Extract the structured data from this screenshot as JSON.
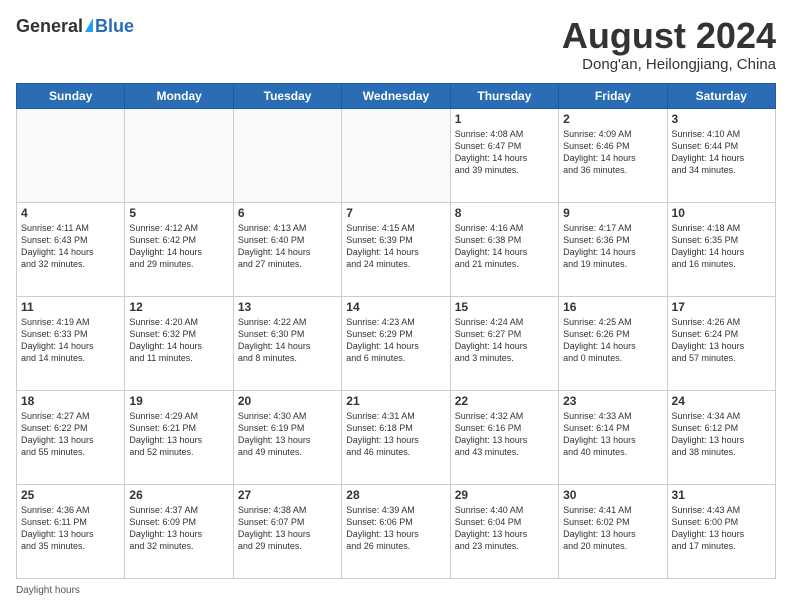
{
  "logo": {
    "general": "General",
    "blue": "Blue"
  },
  "title": {
    "month_year": "August 2024",
    "location": "Dong'an, Heilongjiang, China"
  },
  "days_of_week": [
    "Sunday",
    "Monday",
    "Tuesday",
    "Wednesday",
    "Thursday",
    "Friday",
    "Saturday"
  ],
  "weeks": [
    [
      {
        "day": "",
        "info": ""
      },
      {
        "day": "",
        "info": ""
      },
      {
        "day": "",
        "info": ""
      },
      {
        "day": "",
        "info": ""
      },
      {
        "day": "1",
        "info": "Sunrise: 4:08 AM\nSunset: 6:47 PM\nDaylight: 14 hours\nand 39 minutes."
      },
      {
        "day": "2",
        "info": "Sunrise: 4:09 AM\nSunset: 6:46 PM\nDaylight: 14 hours\nand 36 minutes."
      },
      {
        "day": "3",
        "info": "Sunrise: 4:10 AM\nSunset: 6:44 PM\nDaylight: 14 hours\nand 34 minutes."
      }
    ],
    [
      {
        "day": "4",
        "info": "Sunrise: 4:11 AM\nSunset: 6:43 PM\nDaylight: 14 hours\nand 32 minutes."
      },
      {
        "day": "5",
        "info": "Sunrise: 4:12 AM\nSunset: 6:42 PM\nDaylight: 14 hours\nand 29 minutes."
      },
      {
        "day": "6",
        "info": "Sunrise: 4:13 AM\nSunset: 6:40 PM\nDaylight: 14 hours\nand 27 minutes."
      },
      {
        "day": "7",
        "info": "Sunrise: 4:15 AM\nSunset: 6:39 PM\nDaylight: 14 hours\nand 24 minutes."
      },
      {
        "day": "8",
        "info": "Sunrise: 4:16 AM\nSunset: 6:38 PM\nDaylight: 14 hours\nand 21 minutes."
      },
      {
        "day": "9",
        "info": "Sunrise: 4:17 AM\nSunset: 6:36 PM\nDaylight: 14 hours\nand 19 minutes."
      },
      {
        "day": "10",
        "info": "Sunrise: 4:18 AM\nSunset: 6:35 PM\nDaylight: 14 hours\nand 16 minutes."
      }
    ],
    [
      {
        "day": "11",
        "info": "Sunrise: 4:19 AM\nSunset: 6:33 PM\nDaylight: 14 hours\nand 14 minutes."
      },
      {
        "day": "12",
        "info": "Sunrise: 4:20 AM\nSunset: 6:32 PM\nDaylight: 14 hours\nand 11 minutes."
      },
      {
        "day": "13",
        "info": "Sunrise: 4:22 AM\nSunset: 6:30 PM\nDaylight: 14 hours\nand 8 minutes."
      },
      {
        "day": "14",
        "info": "Sunrise: 4:23 AM\nSunset: 6:29 PM\nDaylight: 14 hours\nand 6 minutes."
      },
      {
        "day": "15",
        "info": "Sunrise: 4:24 AM\nSunset: 6:27 PM\nDaylight: 14 hours\nand 3 minutes."
      },
      {
        "day": "16",
        "info": "Sunrise: 4:25 AM\nSunset: 6:26 PM\nDaylight: 14 hours\nand 0 minutes."
      },
      {
        "day": "17",
        "info": "Sunrise: 4:26 AM\nSunset: 6:24 PM\nDaylight: 13 hours\nand 57 minutes."
      }
    ],
    [
      {
        "day": "18",
        "info": "Sunrise: 4:27 AM\nSunset: 6:22 PM\nDaylight: 13 hours\nand 55 minutes."
      },
      {
        "day": "19",
        "info": "Sunrise: 4:29 AM\nSunset: 6:21 PM\nDaylight: 13 hours\nand 52 minutes."
      },
      {
        "day": "20",
        "info": "Sunrise: 4:30 AM\nSunset: 6:19 PM\nDaylight: 13 hours\nand 49 minutes."
      },
      {
        "day": "21",
        "info": "Sunrise: 4:31 AM\nSunset: 6:18 PM\nDaylight: 13 hours\nand 46 minutes."
      },
      {
        "day": "22",
        "info": "Sunrise: 4:32 AM\nSunset: 6:16 PM\nDaylight: 13 hours\nand 43 minutes."
      },
      {
        "day": "23",
        "info": "Sunrise: 4:33 AM\nSunset: 6:14 PM\nDaylight: 13 hours\nand 40 minutes."
      },
      {
        "day": "24",
        "info": "Sunrise: 4:34 AM\nSunset: 6:12 PM\nDaylight: 13 hours\nand 38 minutes."
      }
    ],
    [
      {
        "day": "25",
        "info": "Sunrise: 4:36 AM\nSunset: 6:11 PM\nDaylight: 13 hours\nand 35 minutes."
      },
      {
        "day": "26",
        "info": "Sunrise: 4:37 AM\nSunset: 6:09 PM\nDaylight: 13 hours\nand 32 minutes."
      },
      {
        "day": "27",
        "info": "Sunrise: 4:38 AM\nSunset: 6:07 PM\nDaylight: 13 hours\nand 29 minutes."
      },
      {
        "day": "28",
        "info": "Sunrise: 4:39 AM\nSunset: 6:06 PM\nDaylight: 13 hours\nand 26 minutes."
      },
      {
        "day": "29",
        "info": "Sunrise: 4:40 AM\nSunset: 6:04 PM\nDaylight: 13 hours\nand 23 minutes."
      },
      {
        "day": "30",
        "info": "Sunrise: 4:41 AM\nSunset: 6:02 PM\nDaylight: 13 hours\nand 20 minutes."
      },
      {
        "day": "31",
        "info": "Sunrise: 4:43 AM\nSunset: 6:00 PM\nDaylight: 13 hours\nand 17 minutes."
      }
    ]
  ],
  "footer": {
    "daylight_hours": "Daylight hours"
  }
}
